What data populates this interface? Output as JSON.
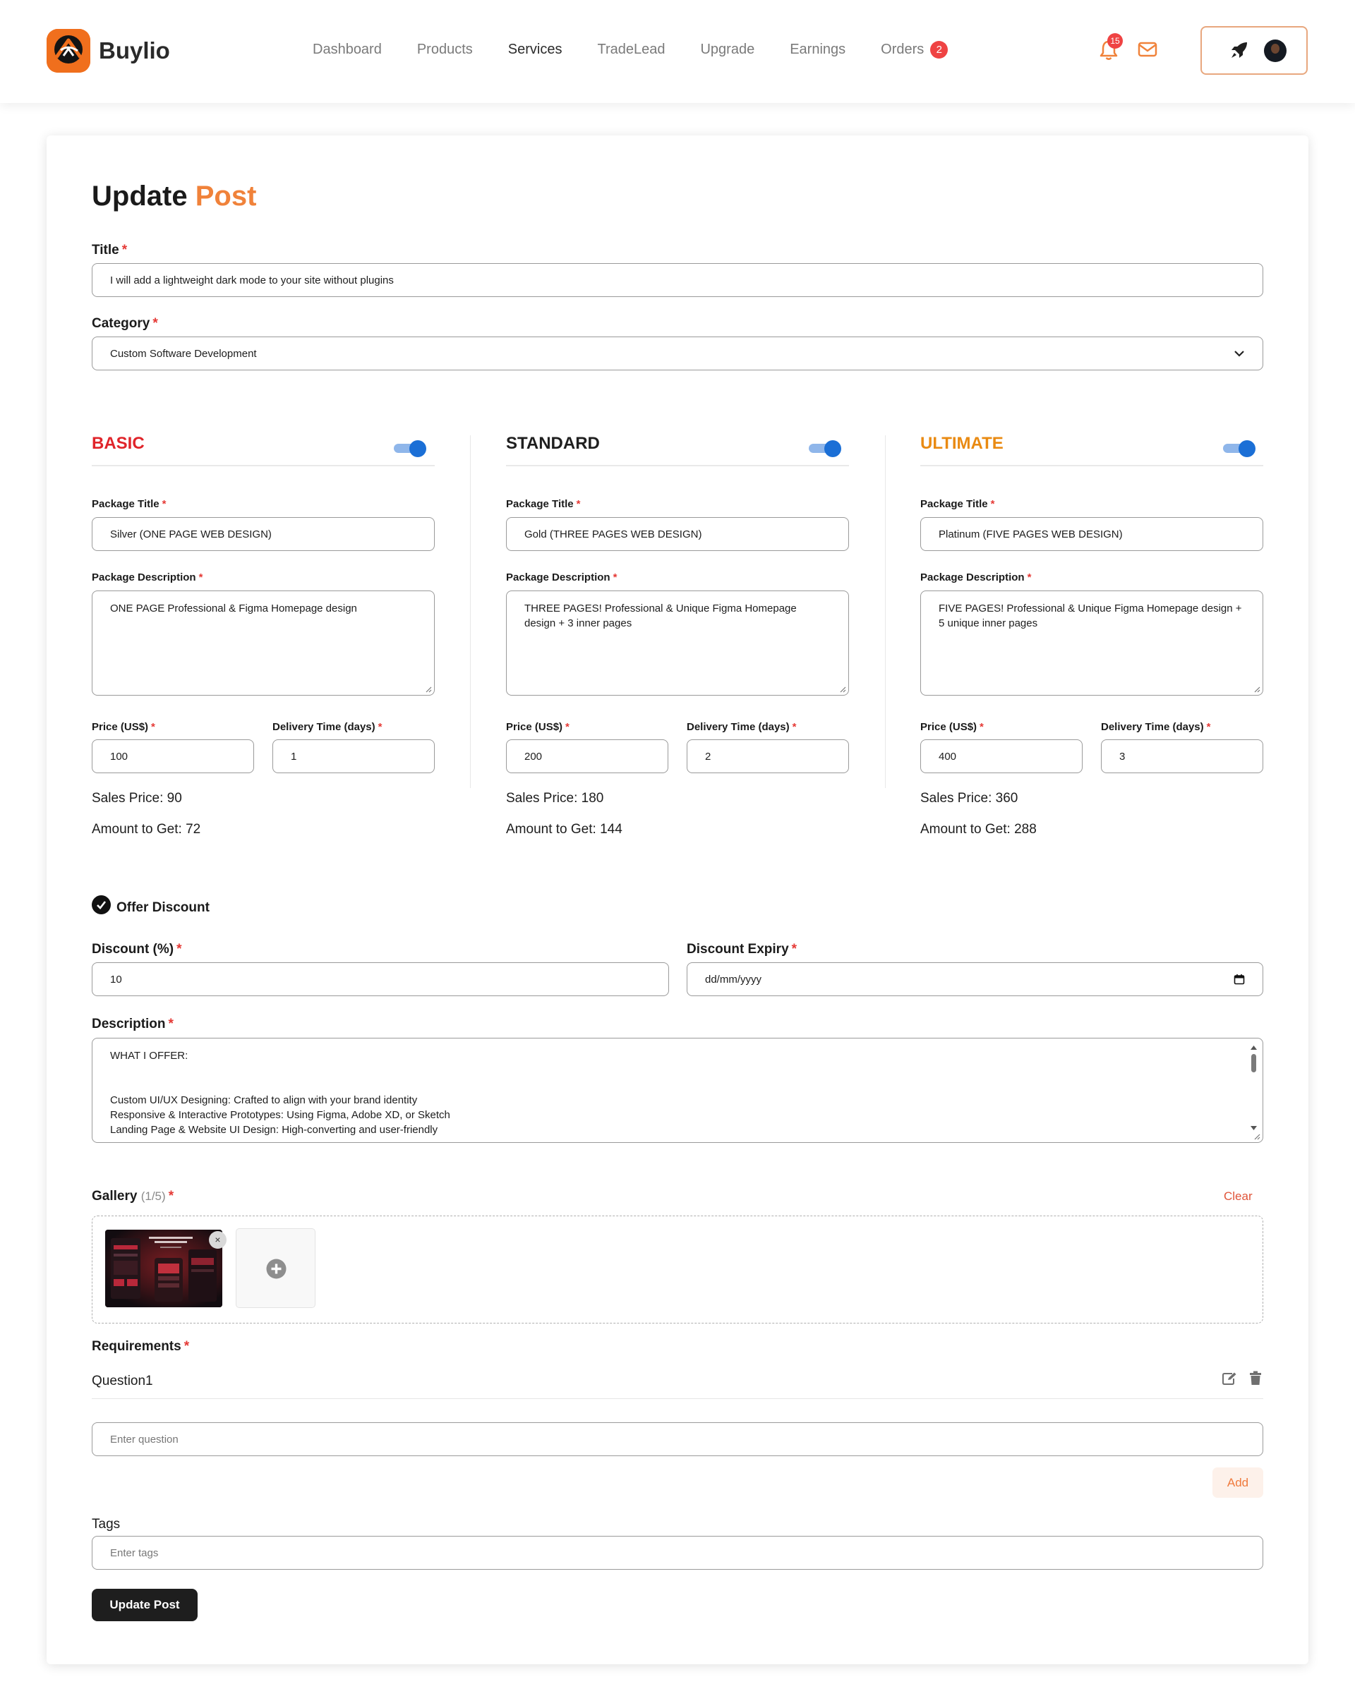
{
  "app": {
    "name": "Buylio"
  },
  "nav": {
    "items": [
      "Dashboard",
      "Products",
      "Services",
      "TradeLead",
      "Upgrade",
      "Earnings",
      "Orders"
    ],
    "active": "Services",
    "orders_badge": "2",
    "notifications_badge": "15"
  },
  "form": {
    "title_part1": "Update",
    "title_part2": "Post",
    "required_mark": "*",
    "title_label": "Title",
    "title_value": "I will add a lightweight dark mode to your site without plugins",
    "category_label": "Category",
    "category_value": "Custom Software Development",
    "packages": [
      {
        "name": "BASIC",
        "color": "#e0242a",
        "enabled": true,
        "title_label": "Package Title",
        "title_value": "Silver (ONE PAGE WEB DESIGN)",
        "desc_label": "Package Description",
        "desc_value": "ONE PAGE Professional & Figma Homepage design",
        "price_label": "Price (US$)",
        "price_value": "100",
        "delivery_label": "Delivery Time (days)",
        "delivery_value": "1",
        "sales_price": "Sales Price: 90",
        "amount_to_get": "Amount to Get: 72"
      },
      {
        "name": "STANDARD",
        "color": "#1f1f1f",
        "enabled": true,
        "title_label": "Package Title",
        "title_value": "Gold (THREE PAGES WEB DESIGN)",
        "desc_label": "Package Description",
        "desc_value": "THREE PAGES! Professional & Unique Figma Homepage design + 3 inner pages",
        "price_label": "Price (US$)",
        "price_value": "200",
        "delivery_label": "Delivery Time (days)",
        "delivery_value": "2",
        "sales_price": "Sales Price: 180",
        "amount_to_get": "Amount to Get: 144"
      },
      {
        "name": "ULTIMATE",
        "color": "#e98a12",
        "enabled": true,
        "title_label": "Package Title",
        "title_value": "Platinum (FIVE PAGES WEB DESIGN)",
        "desc_label": "Package Description",
        "desc_value": "FIVE PAGES! Professional & Unique Figma Homepage design + 5 unique inner pages",
        "price_label": "Price (US$)",
        "price_value": "400",
        "delivery_label": "Delivery Time (days)",
        "delivery_value": "3",
        "sales_price": "Sales Price: 360",
        "amount_to_get": "Amount to Get: 288"
      }
    ],
    "offer_discount_label": "Offer Discount",
    "offer_discount_checked": true,
    "discount_label": "Discount (%)",
    "discount_value": "10",
    "expiry_label": "Discount Expiry",
    "expiry_placeholder": "dd/mm/yyyy",
    "description_label": "Description",
    "description_lines": [
      "WHAT I OFFER:",
      "",
      "",
      "Custom UI/UX Designing: Crafted to align with your brand identity",
      "Responsive & Interactive Prototypes: Using Figma, Adobe XD, or Sketch",
      "Landing Page & Website UI Design: High-converting and user-friendly"
    ],
    "gallery_label": "Gallery",
    "gallery_count": "(1/5)",
    "gallery_clear": "Clear",
    "gallery_remove": "×",
    "requirements_label": "Requirements",
    "requirements": [
      "Question1"
    ],
    "question_placeholder": "Enter question",
    "add_label": "Add",
    "tags_label": "Tags",
    "tags_placeholder": "Enter tags",
    "submit_label": "Update Post"
  },
  "colors": {
    "brand": "#f06f1d",
    "accent": "#f0823a",
    "required": "#e53935",
    "toggle_on": "#1b6fd6",
    "dark_button": "#1e1e1e"
  },
  "icons": [
    "bell-icon",
    "mail-icon",
    "rocket-icon",
    "chevron-down-icon",
    "calendar-icon",
    "check-icon",
    "plus-circle-icon",
    "edit-icon",
    "trash-icon",
    "close-icon"
  ]
}
